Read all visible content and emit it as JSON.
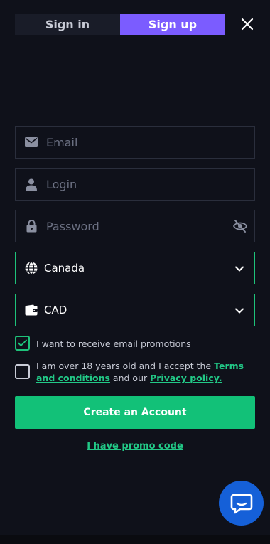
{
  "tabs": {
    "signin": "Sign in",
    "signup": "Sign up"
  },
  "form": {
    "email_placeholder": "Email",
    "login_placeholder": "Login",
    "password_placeholder": "Password",
    "country": "Canada",
    "currency": "CAD"
  },
  "consent": {
    "promotions_text": "I want to receive email promotions",
    "promotions_checked": true,
    "terms_prefix": "I am over 18 years old and I accept the ",
    "terms_link": "Terms and conditions",
    "terms_middle": " and our ",
    "privacy_link": "Privacy policy.",
    "terms_checked": false
  },
  "actions": {
    "create_account": "Create an Account",
    "promo_code": "I have promo code"
  },
  "colors": {
    "accent_green": "#1ec27a",
    "tab_active": "#7b5cff",
    "chat_blue": "#1560d8"
  }
}
